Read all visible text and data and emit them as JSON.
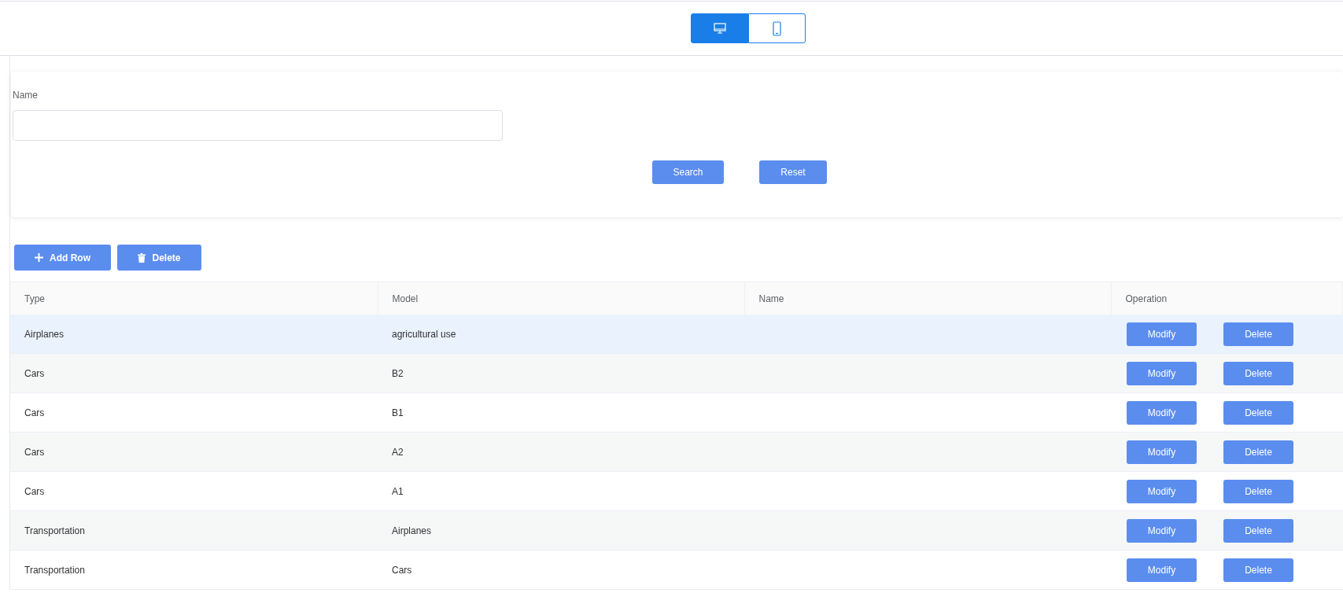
{
  "view_toggle": [
    {
      "kind": "desktop",
      "selected": true
    },
    {
      "kind": "mobile",
      "selected": false
    }
  ],
  "search_form": {
    "field_label": "Name",
    "buttons": [
      "Search",
      "Reset"
    ]
  },
  "toolbar": [
    {
      "kind": "add",
      "label": "Add Row"
    },
    {
      "kind": "delete",
      "label": "Delete"
    }
  ],
  "table": {
    "columns": [
      "Type",
      "Model",
      "Name",
      "Operation"
    ],
    "rows": [
      {
        "type": "Airplanes",
        "model": "agricultural use",
        "highlighted": true,
        "actions": [
          "Modify",
          "Delete"
        ]
      },
      {
        "type": "Cars",
        "model": "B2",
        "highlighted": false,
        "actions": [
          "Modify",
          "Delete"
        ]
      },
      {
        "type": "Cars",
        "model": "B1",
        "highlighted": false,
        "actions": [
          "Modify",
          "Delete"
        ]
      },
      {
        "type": "Cars",
        "model": "A2",
        "highlighted": false,
        "actions": [
          "Modify",
          "Delete"
        ]
      },
      {
        "type": "Cars",
        "model": "A1",
        "highlighted": false,
        "actions": [
          "Modify",
          "Delete"
        ]
      },
      {
        "type": "Transportation",
        "model": "Airplanes",
        "highlighted": false,
        "actions": [
          "Modify",
          "Delete"
        ]
      },
      {
        "type": "Transportation",
        "model": "Cars",
        "highlighted": false,
        "actions": [
          "Modify",
          "Delete"
        ]
      }
    ]
  }
}
